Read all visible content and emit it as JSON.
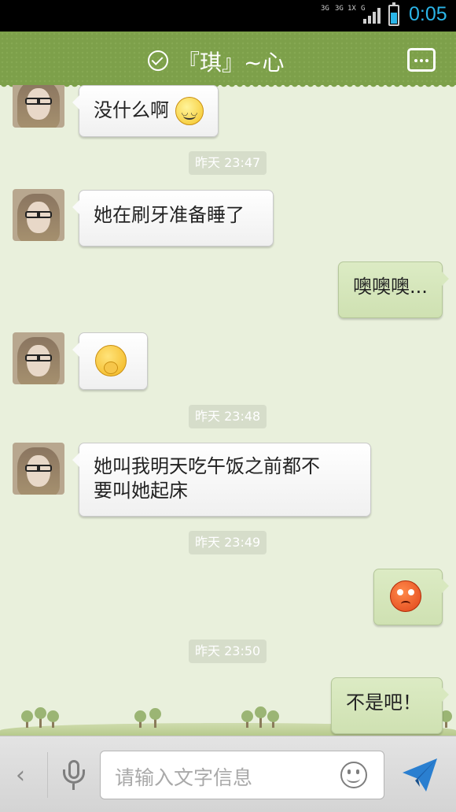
{
  "status_bar": {
    "time": "0:05",
    "network_labels": [
      "3G",
      "3G",
      "1X",
      "G"
    ],
    "battery_level": 0.6
  },
  "header": {
    "title": "『琪』~心",
    "accent_color": "#7da04a"
  },
  "messages": [
    {
      "side": "left",
      "text": "没什么啊",
      "emoji": "smile-emoji"
    },
    {
      "type": "time",
      "text": "昨天 23:47"
    },
    {
      "side": "left",
      "text": "她在刷牙准备睡了"
    },
    {
      "side": "right",
      "text": "噢噢噢..."
    },
    {
      "side": "left",
      "emoji": "shy-emoji"
    },
    {
      "type": "time",
      "text": "昨天 23:48"
    },
    {
      "side": "left",
      "text_lines": [
        "她叫我明天吃午饭之前都不",
        "要叫她起床"
      ]
    },
    {
      "type": "time",
      "text": "昨天 23:49"
    },
    {
      "side": "right",
      "emoji": "angry-emoji"
    },
    {
      "type": "time",
      "text": "昨天 23:50"
    },
    {
      "side": "right",
      "text": "不是吧！"
    }
  ],
  "input_bar": {
    "placeholder": "请输入文字信息",
    "back_label": "‹",
    "send_color": "#2a7fd0"
  }
}
